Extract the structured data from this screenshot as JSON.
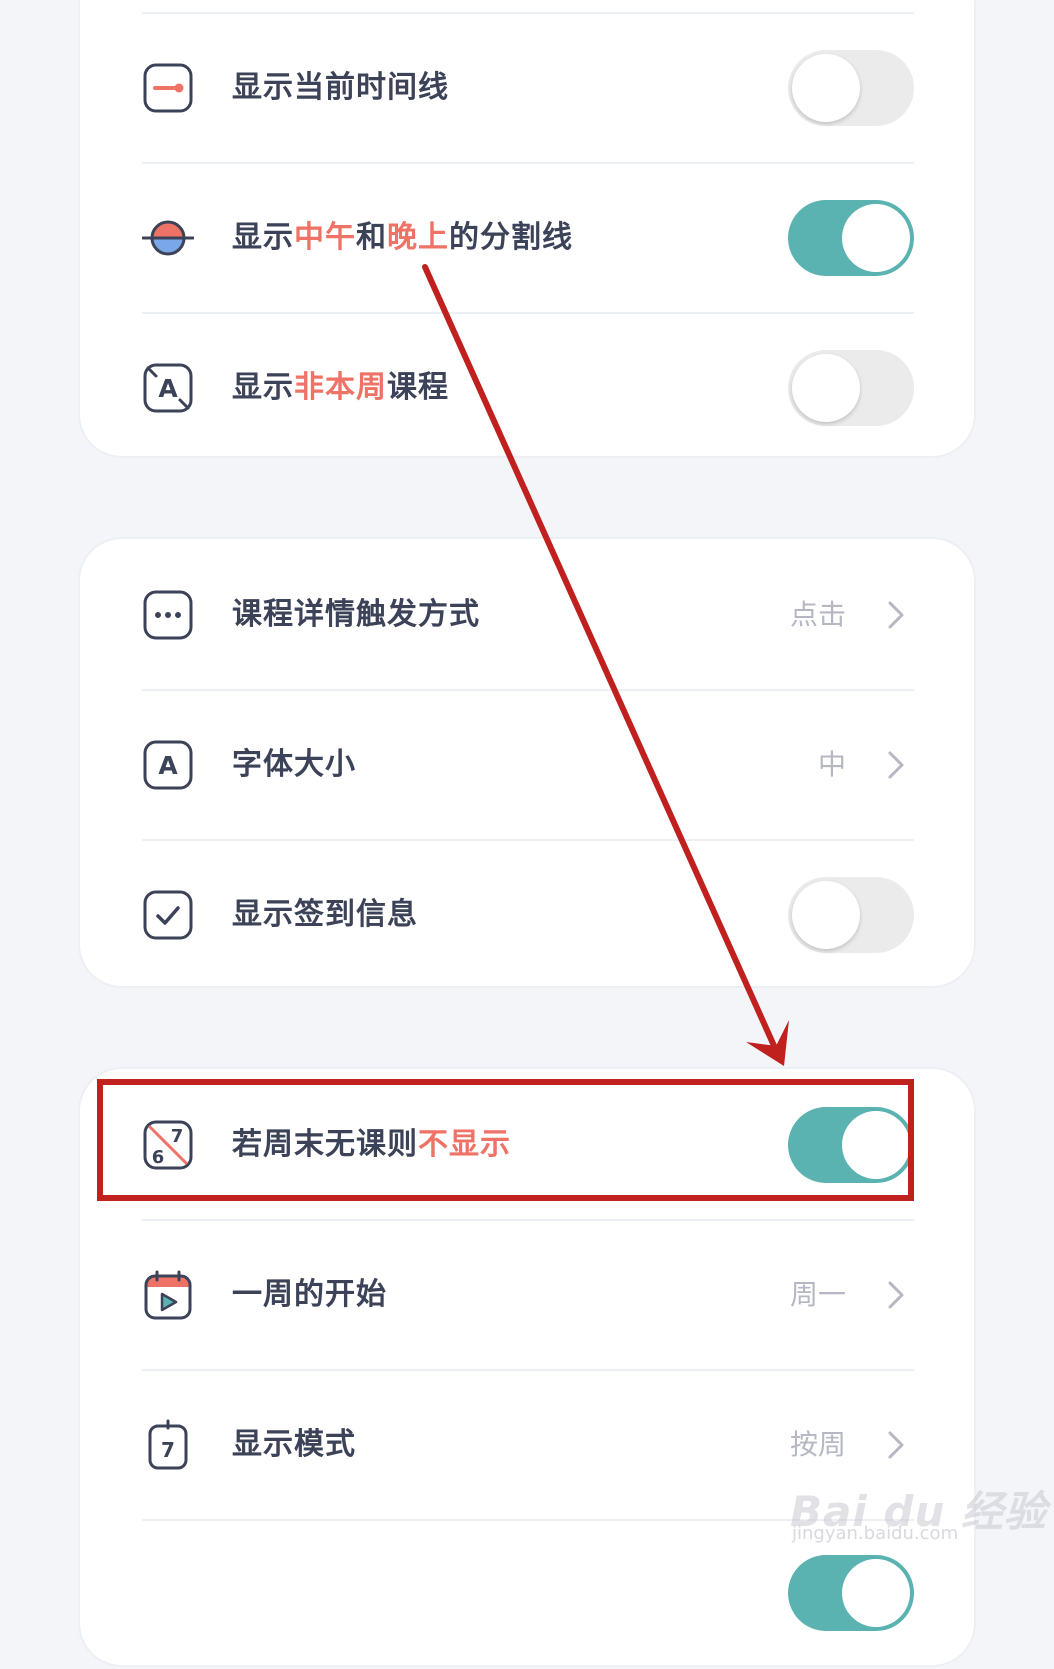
{
  "card1": {
    "rows": [
      {
        "label": "显示当前时间线",
        "toggle": false
      },
      {
        "label_parts": [
          "显示",
          "中午",
          "和",
          "晚上",
          "的分割线"
        ],
        "toggle": true
      },
      {
        "label_parts": [
          "显示",
          "非本周",
          "课程"
        ],
        "toggle": false
      }
    ]
  },
  "card2": {
    "rows": [
      {
        "label": "课程详情触发方式",
        "value": "点击"
      },
      {
        "label": "字体大小",
        "value": "中"
      },
      {
        "label": "显示签到信息",
        "toggle": false
      }
    ]
  },
  "card3": {
    "rows": [
      {
        "label_parts": [
          "若周末无课则",
          "不显示"
        ],
        "toggle": true
      },
      {
        "label": "一周的开始",
        "value": "周一"
      },
      {
        "label": "显示模式",
        "value": "按周"
      },
      {
        "toggle": true
      }
    ]
  },
  "icons": {
    "calendar_icon_text": "7",
    "weekend_icon_text": [
      "6",
      "7"
    ]
  },
  "watermark": {
    "logo": "Bai du 经验",
    "url": "jingyan.baidu.com"
  },
  "colors": {
    "accent_teal": "#5bb3b1",
    "highlight_red": "#ee7366",
    "annotation_red": "#c0211f"
  }
}
